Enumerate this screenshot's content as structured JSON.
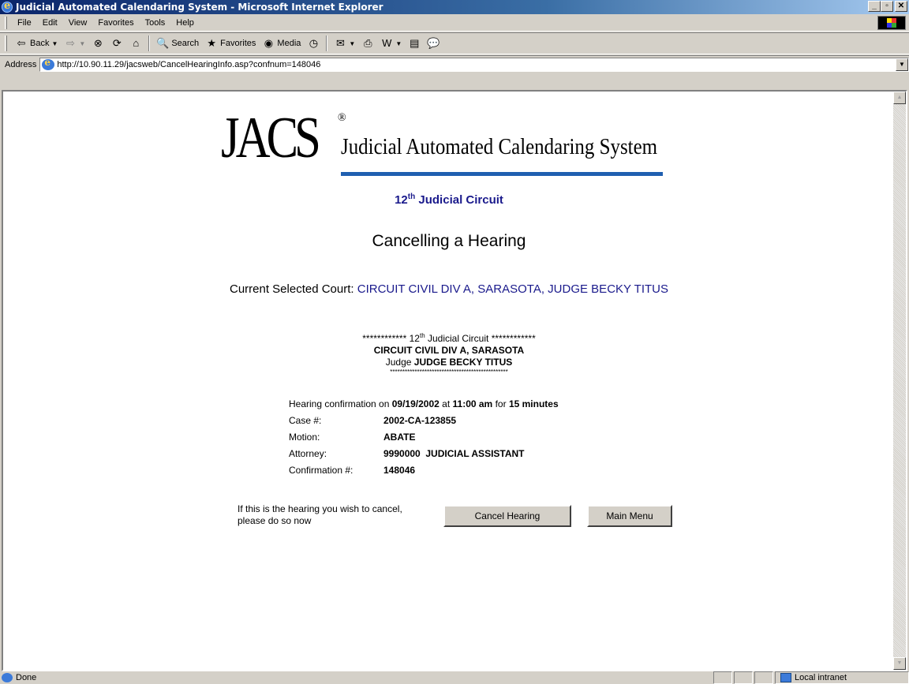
{
  "window": {
    "title": "Judicial Automated Calendaring System - Microsoft Internet Explorer"
  },
  "menu": [
    "File",
    "Edit",
    "View",
    "Favorites",
    "Tools",
    "Help"
  ],
  "toolbar": {
    "back": "Back",
    "search": "Search",
    "favorites": "Favorites",
    "media": "Media"
  },
  "address": {
    "label": "Address",
    "url": "http://10.90.11.29/jacsweb/CancelHearingInfo.asp?confnum=148046"
  },
  "logo": {
    "mark": "JACS",
    "reg": "®",
    "tagline": "Judicial Automated Calendaring System"
  },
  "circuit": {
    "number": "12",
    "suffix": "th",
    "label": "Judicial Circuit"
  },
  "heading": "Cancelling a Hearing",
  "court": {
    "label": "Current Selected Court:",
    "value": "CIRCUIT CIVIL DIV A, SARASOTA, JUDGE BECKY TITUS"
  },
  "confirmation_box": {
    "stars_left": "************",
    "circuit_number": "12",
    "circuit_suffix": "th",
    "circuit_label": "Judicial Circuit",
    "stars_right": "************",
    "division": "CIRCUIT CIVIL DIV A, SARASOTA",
    "judge_prefix": "Judge",
    "judge_name": "JUDGE BECKY TITUS",
    "stars_line": "************************************************"
  },
  "hearing": {
    "intro": "Hearing confirmation on",
    "date": "09/19/2002",
    "at": "at",
    "time": "11:00 am",
    "for": "for",
    "duration": "15 minutes",
    "rows": [
      {
        "label": "Case #:",
        "value": "2002-CA-123855"
      },
      {
        "label": "Motion:",
        "value": "ABATE"
      },
      {
        "label": "Attorney:",
        "value": "9990000  JUDICIAL ASSISTANT"
      },
      {
        "label": "Confirmation #:",
        "value": "148046"
      }
    ]
  },
  "cancel_prompt": {
    "line1": "If this is the hearing you wish to cancel,",
    "line2": "please do so now"
  },
  "buttons": {
    "cancel": "Cancel Hearing",
    "main_menu": "Main Menu"
  },
  "status": {
    "text": "Done",
    "zone": "Local intranet"
  }
}
